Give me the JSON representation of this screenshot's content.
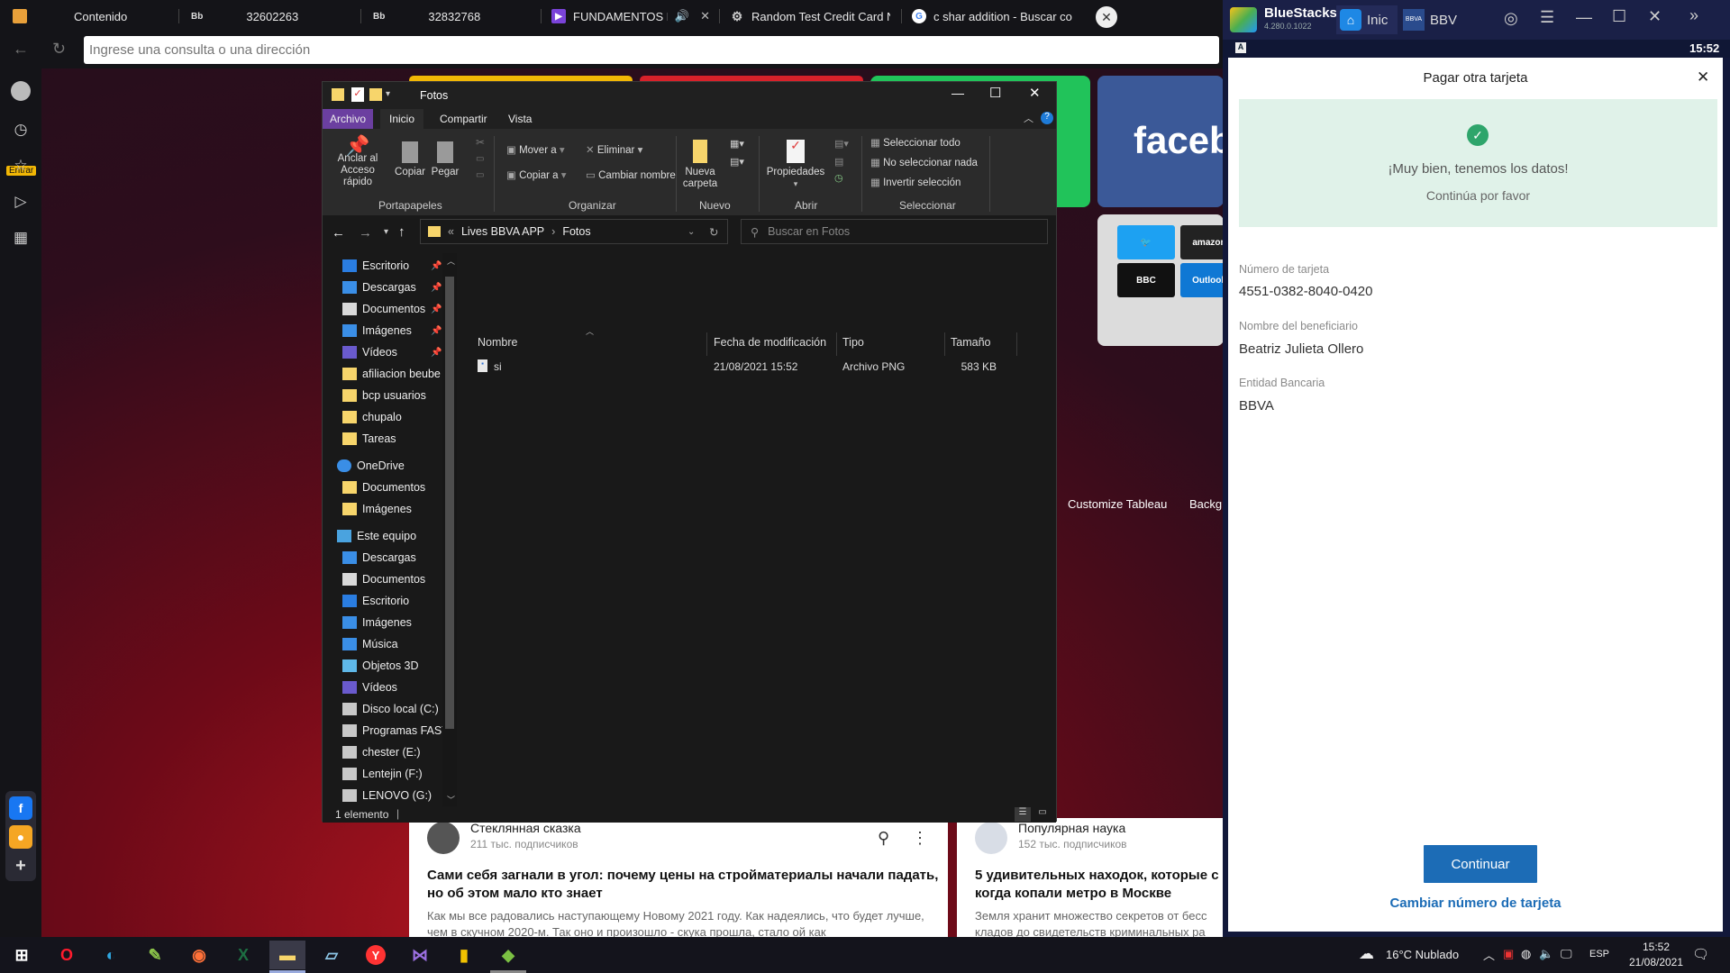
{
  "browser": {
    "tabs": [
      {
        "label": "Contenido",
        "icon": "speed-dial-icon",
        "color": "#e8a03a"
      },
      {
        "label": "32602263",
        "icon": "bb-icon"
      },
      {
        "label": "32832768",
        "icon": "bb-icon"
      },
      {
        "label": "FUNDAMENTOS DE P",
        "icon": "video-icon",
        "color": "#7a43d9"
      },
      {
        "label": "Random Test Credit Card N",
        "icon": "gear-icon"
      },
      {
        "label": "c shar addition - Buscar co",
        "icon": "google-icon"
      }
    ],
    "tab_badge": "Bb",
    "address_placeholder": "Ingrese una consulta o una dirección",
    "entrar_label": "Entrar",
    "speed_dial": {
      "facebook_label": "faceb",
      "twitter": "twitter",
      "amazon": "amazon",
      "bbc": "BBC",
      "outlook": "Outlook",
      "customize_label": "Customize Tableau",
      "background_label": "Backgr"
    },
    "news": [
      {
        "channel": "Стеклянная сказка",
        "subscribers": "211 тыс. подписчиков",
        "headline": "Сами себя загнали в угол: почему цены на стройматериалы начали падать, но об этом мало кто знает",
        "excerpt": "Как мы все радовались наступающему Новому 2021 году. Как надеялись, что будет лучше, чем в скучном 2020-м. Так оно и произошло - скука прошла, стало ой как"
      },
      {
        "channel": "Популярная наука",
        "subscribers": "152 тыс. подписчиков",
        "headline": "5 удивительных находок, которые с когда копали метро в Москве",
        "excerpt": "Земля хранит множество секретов от бесс кладов до свидетельств криминальных ра"
      }
    ]
  },
  "explorer": {
    "title": "Fotos",
    "ribbon_tabs": [
      "Archivo",
      "Inicio",
      "Compartir",
      "Vista"
    ],
    "ribbon": {
      "anclar": "Anclar al Acceso rápido",
      "copiar": "Copiar",
      "pegar": "Pegar",
      "mover": "Mover a",
      "copiar_a": "Copiar a",
      "eliminar": "Eliminar",
      "cambiar_nombre": "Cambiar nombre",
      "nueva_carpeta": "Nueva carpeta",
      "propiedades": "Propiedades",
      "seleccionar_todo": "Seleccionar todo",
      "no_seleccionar": "No seleccionar nada",
      "invertir": "Invertir selección",
      "groups": [
        "Portapapeles",
        "Organizar",
        "Nuevo",
        "Abrir",
        "Seleccionar"
      ]
    },
    "path": [
      "Lives BBVA APP",
      "Fotos"
    ],
    "search_placeholder": "Buscar en Fotos",
    "tree": [
      {
        "label": "Escritorio",
        "icon": "desktop-icon",
        "pinned": true
      },
      {
        "label": "Descargas",
        "icon": "download-icon",
        "pinned": true
      },
      {
        "label": "Documentos",
        "icon": "document-icon",
        "pinned": true
      },
      {
        "label": "Imágenes",
        "icon": "pictures-icon",
        "pinned": true
      },
      {
        "label": "Vídeos",
        "icon": "videos-icon",
        "pinned": true
      },
      {
        "label": "afiliacion beube",
        "icon": "folder-icon"
      },
      {
        "label": "bcp usuarios",
        "icon": "folder-icon"
      },
      {
        "label": "chupalo",
        "icon": "folder-icon"
      },
      {
        "label": "Tareas",
        "icon": "folder-icon"
      },
      {
        "label": "OneDrive",
        "icon": "cloud-icon"
      },
      {
        "label": "Documentos",
        "icon": "folder-icon"
      },
      {
        "label": "Imágenes",
        "icon": "folder-icon"
      },
      {
        "label": "Este equipo",
        "icon": "computer-icon"
      },
      {
        "label": "Descargas",
        "icon": "download-icon"
      },
      {
        "label": "Documentos",
        "icon": "document-icon"
      },
      {
        "label": "Escritorio",
        "icon": "desktop-icon"
      },
      {
        "label": "Imágenes",
        "icon": "pictures-icon"
      },
      {
        "label": "Música",
        "icon": "music-icon"
      },
      {
        "label": "Objetos 3D",
        "icon": "cube-icon"
      },
      {
        "label": "Vídeos",
        "icon": "videos-icon"
      },
      {
        "label": "Disco local (C:)",
        "icon": "drive-icon"
      },
      {
        "label": "Programas FAST",
        "icon": "drive-icon"
      },
      {
        "label": "chester (E:)",
        "icon": "drive-icon"
      },
      {
        "label": "Lentejin (F:)",
        "icon": "drive-icon"
      },
      {
        "label": "LENOVO (G:)",
        "icon": "drive-icon"
      }
    ],
    "columns": [
      "Nombre",
      "Fecha de modificación",
      "Tipo",
      "Tamaño"
    ],
    "files": [
      {
        "name": "si",
        "modified": "21/08/2021 15:52",
        "type": "Archivo PNG",
        "size": "583 KB"
      }
    ],
    "status": "1 elemento"
  },
  "bluestacks": {
    "brand": "BlueStacks",
    "version": "4.280.0.1022",
    "tab_home": "Inic",
    "tab_app": "BBV",
    "app_badge": "BBVA",
    "clock": "15:52",
    "screen_title": "Pagar otra tarjeta",
    "success_title": "¡Muy bien, tenemos los datos!",
    "success_sub": "Continúa por favor",
    "fields": [
      {
        "label": "Número de tarjeta",
        "value": "4551-0382-8040-0420"
      },
      {
        "label": "Nombre del beneficiario",
        "value": "Beatriz Julieta Ollero"
      },
      {
        "label": "Entidad Bancaria",
        "value": "BBVA"
      }
    ],
    "continue_label": "Continuar",
    "change_link": "Cambiar número de tarjeta"
  },
  "taskbar": {
    "weather": "16°C  Nublado",
    "lang": "ESP",
    "time": "15:52",
    "date": "21/08/2021"
  },
  "colors": {
    "accent_blue": "#1c6cb6",
    "success_green": "#2ea56b",
    "archivo_tab": "#6b3fa0"
  }
}
